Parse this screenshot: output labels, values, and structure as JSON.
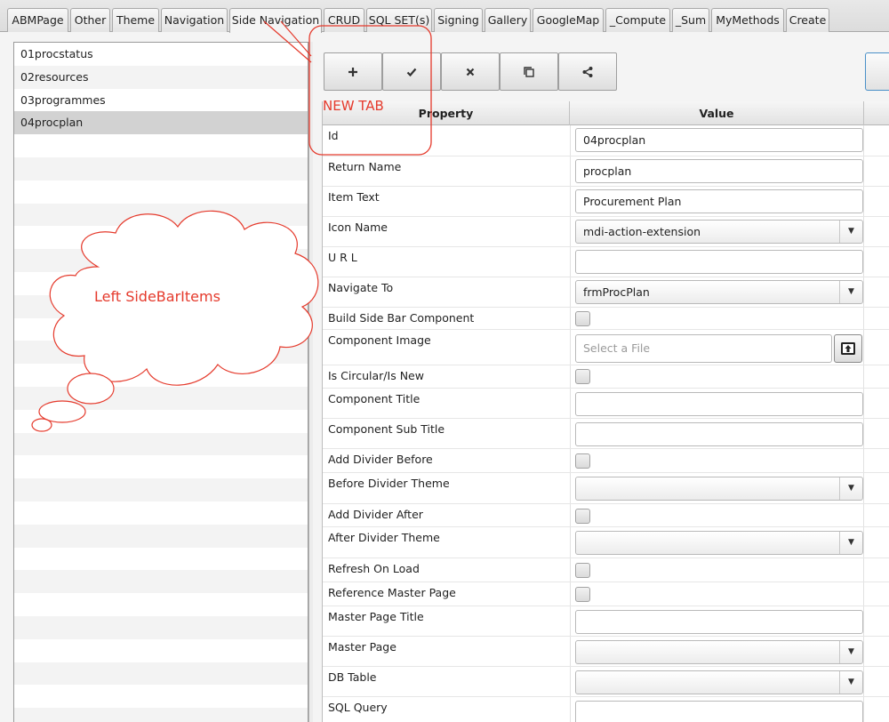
{
  "tabs": [
    {
      "label": "ABMPage"
    },
    {
      "label": "Other"
    },
    {
      "label": "Theme"
    },
    {
      "label": "Navigation"
    },
    {
      "label": "Side Navigation"
    },
    {
      "label": "CRUD"
    },
    {
      "label": "SQL SET(s)"
    },
    {
      "label": "Signing"
    },
    {
      "label": "Gallery"
    },
    {
      "label": "GoogleMap"
    },
    {
      "label": "_Compute"
    },
    {
      "label": "_Sum"
    },
    {
      "label": "MyMethods"
    },
    {
      "label": "Create"
    }
  ],
  "active_tab": "Side Navigation",
  "side_items": [
    {
      "label": "01procstatus"
    },
    {
      "label": "02resources"
    },
    {
      "label": "03programmes"
    },
    {
      "label": "04procplan"
    }
  ],
  "selected_item": "04procplan",
  "toolbar": {
    "icons": [
      "plus-icon",
      "check-icon",
      "times-icon",
      "copy-icon",
      "share-icon"
    ]
  },
  "table": {
    "col_property": "Property",
    "col_value": "Value",
    "rows": [
      {
        "label": "Id",
        "type": "text",
        "value": "04procplan"
      },
      {
        "label": "Return Name",
        "type": "text",
        "value": "procplan"
      },
      {
        "label": "Item Text",
        "type": "text",
        "value": "Procurement Plan"
      },
      {
        "label": "Icon Name",
        "type": "combo",
        "value": "mdi-action-extension"
      },
      {
        "label": "U R L",
        "type": "text",
        "value": ""
      },
      {
        "label": "Navigate To",
        "type": "combo",
        "value": "frmProcPlan"
      },
      {
        "label": "Build Side Bar Component",
        "type": "check",
        "value": false
      },
      {
        "label": "Component Image",
        "type": "file",
        "value": "",
        "placeholder": "Select a File"
      },
      {
        "label": "Is Circular/Is New",
        "type": "check",
        "value": false
      },
      {
        "label": "Component Title",
        "type": "text",
        "value": ""
      },
      {
        "label": "Component Sub Title",
        "type": "text",
        "value": ""
      },
      {
        "label": "Add Divider Before",
        "type": "check",
        "value": false
      },
      {
        "label": "Before Divider Theme",
        "type": "combo",
        "value": ""
      },
      {
        "label": "Add Divider After",
        "type": "check",
        "value": false
      },
      {
        "label": "After Divider Theme",
        "type": "combo",
        "value": ""
      },
      {
        "label": "Refresh On Load",
        "type": "check",
        "value": false
      },
      {
        "label": "Reference Master Page",
        "type": "check",
        "value": false
      },
      {
        "label": "Master Page Title",
        "type": "text",
        "value": ""
      },
      {
        "label": "Master Page",
        "type": "combo",
        "value": ""
      },
      {
        "label": "DB Table",
        "type": "combo",
        "value": ""
      },
      {
        "label": "SQL Query",
        "type": "text",
        "value": ""
      }
    ]
  },
  "annotations": {
    "new_tab": "NEW TAB",
    "left_sidebar": "Left SideBarItems",
    "color": "#e53a2c"
  }
}
